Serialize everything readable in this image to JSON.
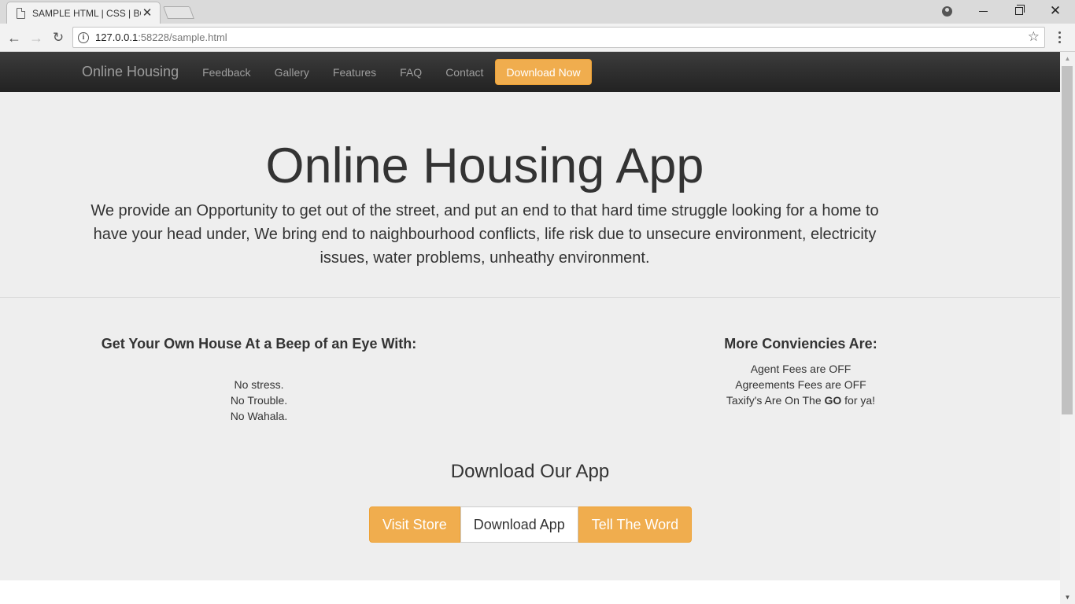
{
  "browser": {
    "tab_title": "SAMPLE HTML | CSS | BO",
    "url_host": "127.0.0.1",
    "url_rest": ":58228/sample.html"
  },
  "site": {
    "brand": "Online Housing",
    "nav": [
      {
        "label": "Feedback"
      },
      {
        "label": "Gallery"
      },
      {
        "label": "Features"
      },
      {
        "label": "FAQ"
      },
      {
        "label": "Contact"
      }
    ],
    "download_button": "Download Now"
  },
  "hero": {
    "title": "Online Housing App",
    "text": "We provide an Opportunity to get out of the street, and put an end to that hard time struggle looking for a home to have your head under, We bring end to naighbourhood conflicts, life risk due to unsecure environment, electricity issues, water problems, unheathy environment."
  },
  "features": {
    "left_heading": "Get Your Own House At a Beep of an Eye With:",
    "left_items": [
      "No stress.",
      "No Trouble.",
      "No Wahala."
    ],
    "right_heading": "More Conviencies Are:",
    "right_items": [
      "Agent Fees are OFF",
      "Agreements Fees are OFF"
    ],
    "right_item3_pre": "Taxify's Are On The ",
    "right_item3_bold": "GO",
    "right_item3_post": " for ya!"
  },
  "download": {
    "title": "Download Our App",
    "buttons": [
      "Visit Store",
      "Download App",
      "Tell The Word"
    ]
  },
  "colors": {
    "accent": "#f0ad4e",
    "navbar": "#222222",
    "background": "#eeeeee"
  }
}
